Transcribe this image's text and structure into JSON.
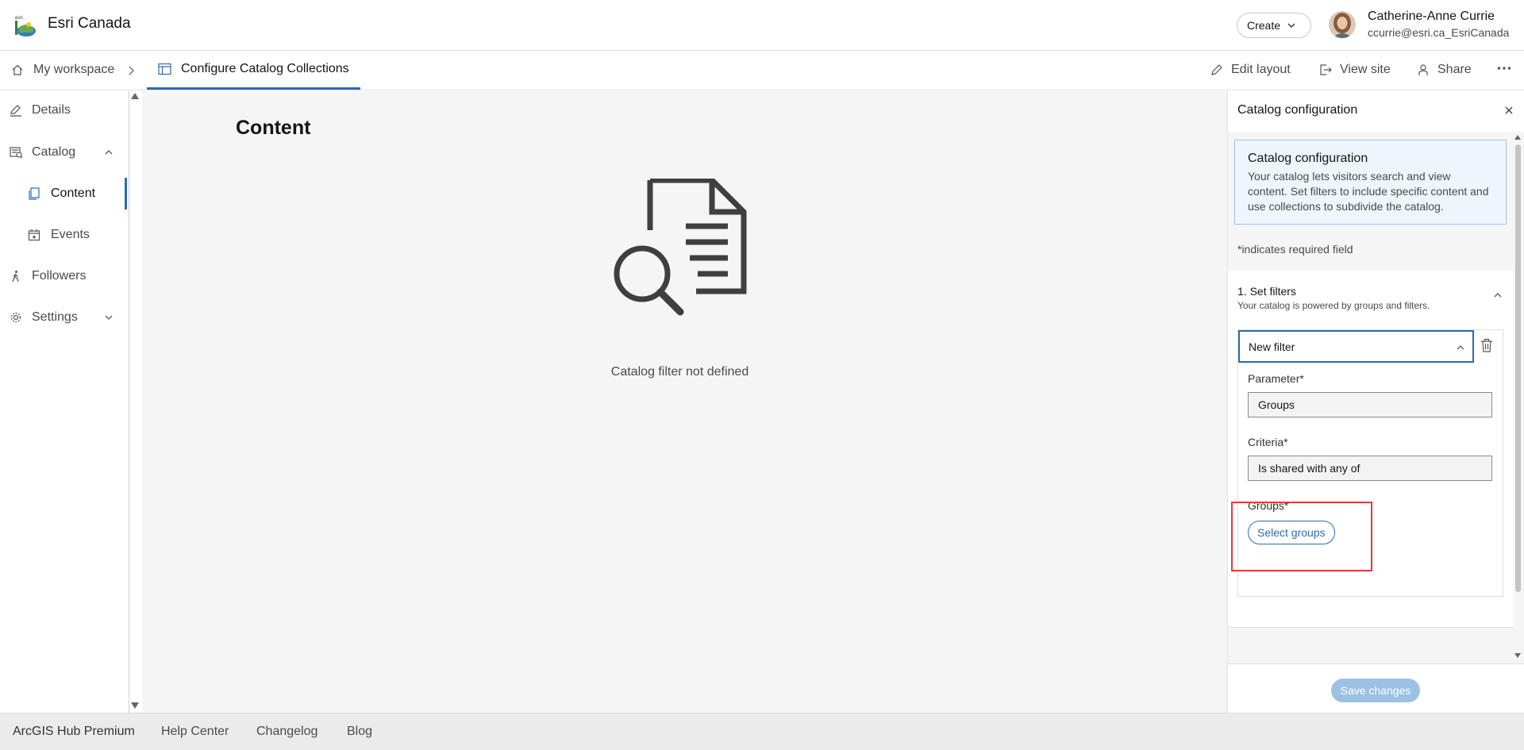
{
  "header": {
    "org_name": "Esri Canada",
    "create_label": "Create",
    "user_name": "Catherine-Anne Currie",
    "user_email": "ccurrie@esri.ca_EsriCanada"
  },
  "navbar": {
    "home_label": "My workspace",
    "current_label": "Configure Catalog Collections",
    "actions": {
      "edit_layout": "Edit layout",
      "view_site": "View site",
      "share": "Share"
    }
  },
  "sidebar": {
    "items": [
      {
        "label": "Details",
        "icon": "pencil-icon"
      },
      {
        "label": "Catalog",
        "icon": "catalog-icon",
        "expanded": true
      },
      {
        "label": "Content",
        "icon": "content-icon",
        "active": true
      },
      {
        "label": "Events",
        "icon": "calendar-icon"
      },
      {
        "label": "Followers",
        "icon": "walking-person-icon"
      },
      {
        "label": "Settings",
        "icon": "gear-icon",
        "expanded": false
      }
    ]
  },
  "main": {
    "title": "Content",
    "empty_message": "Catalog filter not defined"
  },
  "panel": {
    "header": "Catalog configuration",
    "info_title": "Catalog configuration",
    "info_body": "Your catalog lets visitors search and view content. Set filters to include specific content and use collections to subdivide the catalog.",
    "required_note": "*indicates required field",
    "section_title": "1. Set filters",
    "section_subtitle": "Your catalog is powered by groups and filters.",
    "filter": {
      "title": "New filter",
      "parameter_label": "Parameter*",
      "parameter_value": "Groups",
      "criteria_label": "Criteria*",
      "criteria_value": "Is shared with any of",
      "groups_label": "Groups*",
      "select_groups_label": "Select groups"
    },
    "save_label": "Save changes"
  },
  "footer": {
    "links": [
      "ArcGIS Hub Premium",
      "Help Center",
      "Changelog",
      "Blog"
    ]
  },
  "colors": {
    "accent": "#2b6bb0",
    "highlight": "#e03c3c"
  }
}
